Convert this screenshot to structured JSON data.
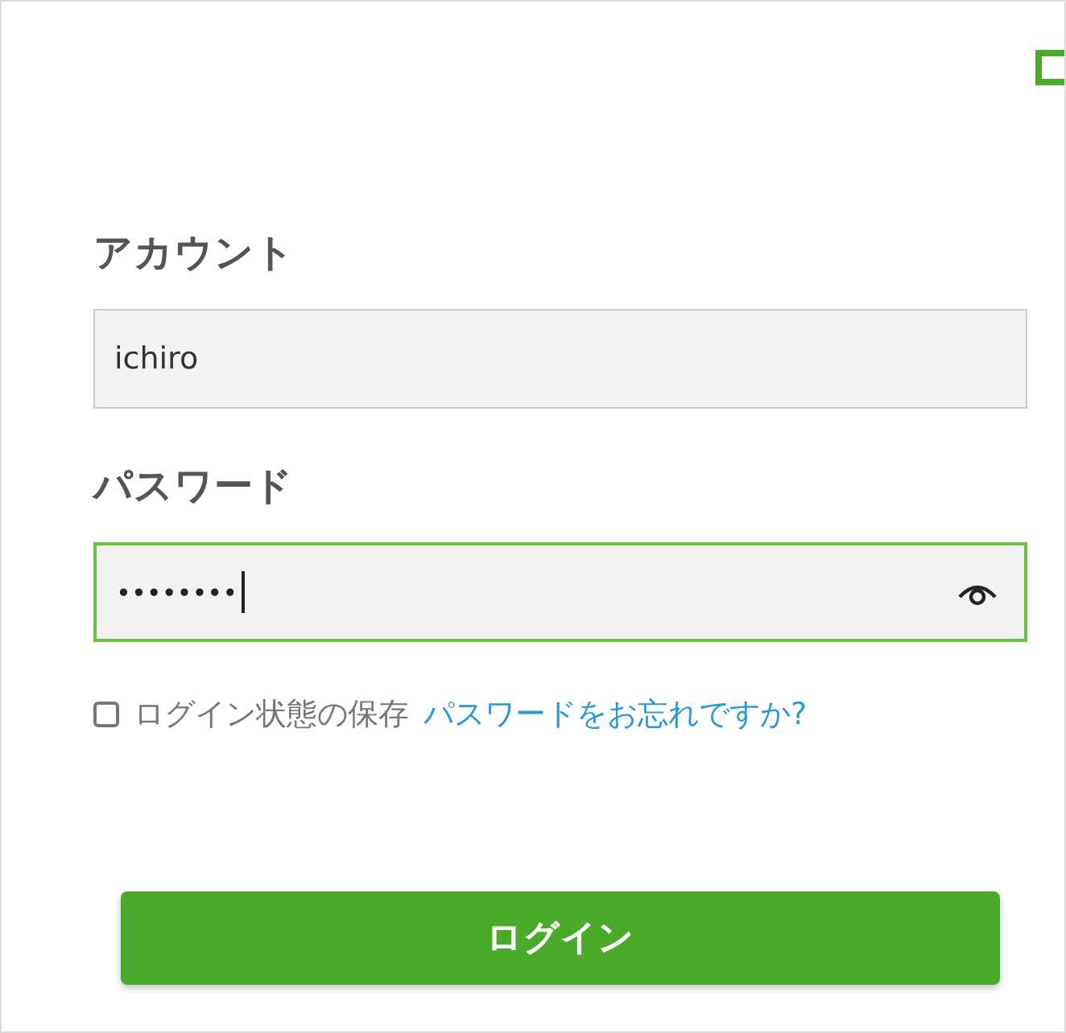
{
  "account": {
    "label": "アカウント",
    "value": "ichiro"
  },
  "password": {
    "label": "パスワード",
    "value": "••••••••",
    "focused": true
  },
  "remember": {
    "label": "ログイン状態の保存",
    "checked": false
  },
  "forgot_link": "パスワードをお忘れですか?",
  "login_button": "ログイン"
}
